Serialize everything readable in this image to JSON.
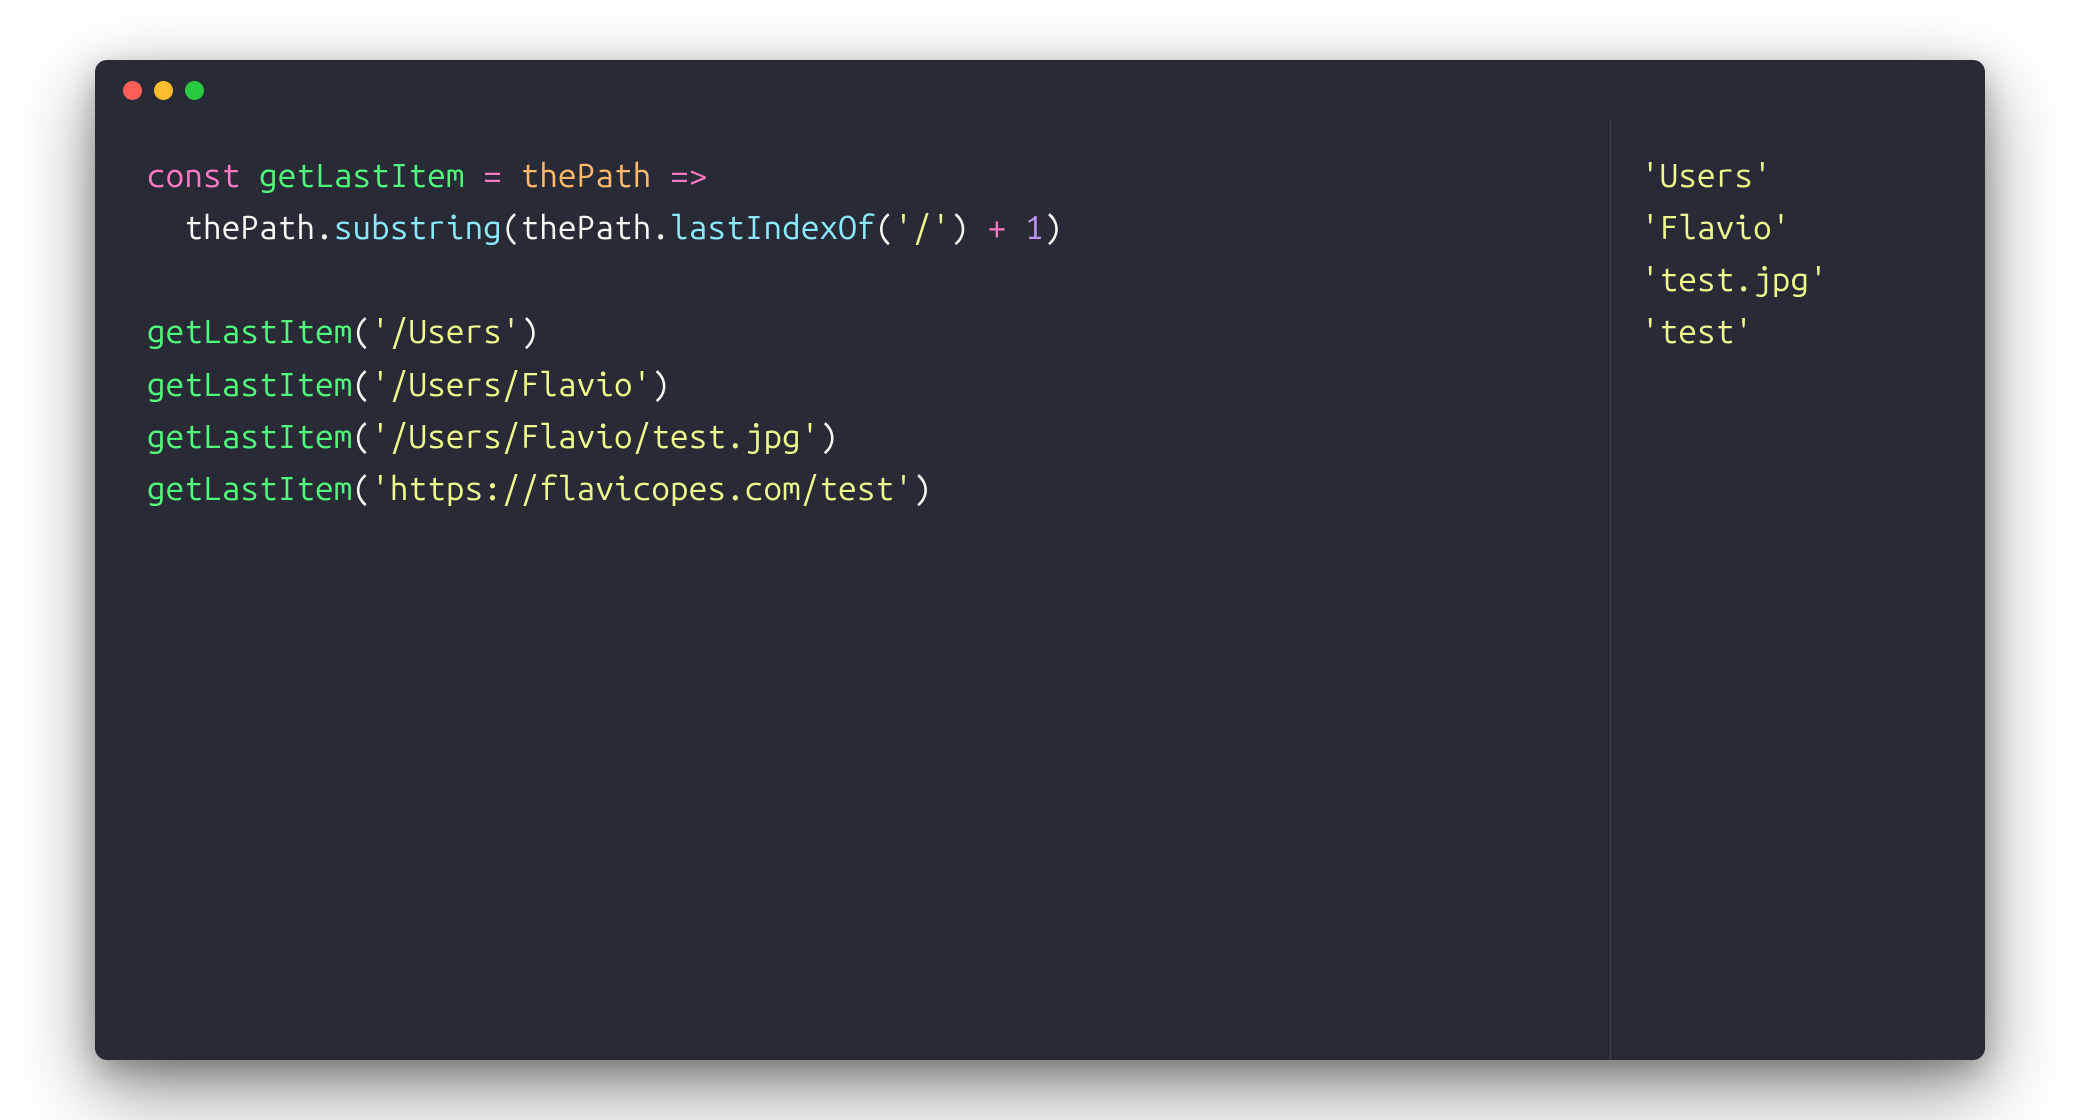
{
  "window": {
    "traffic_lights": [
      "close",
      "minimize",
      "zoom"
    ]
  },
  "code": {
    "lines": [
      [
        {
          "t": "const ",
          "c": "tok-keyword"
        },
        {
          "t": "getLastItem ",
          "c": "tok-func-def"
        },
        {
          "t": "= ",
          "c": "tok-operator"
        },
        {
          "t": "thePath ",
          "c": "tok-param"
        },
        {
          "t": "=>",
          "c": "tok-operator"
        }
      ],
      [
        {
          "t": "  thePath",
          "c": "tok-ident"
        },
        {
          "t": ".",
          "c": "tok-punct"
        },
        {
          "t": "substring",
          "c": "tok-method"
        },
        {
          "t": "(",
          "c": "tok-punct"
        },
        {
          "t": "thePath",
          "c": "tok-ident"
        },
        {
          "t": ".",
          "c": "tok-punct"
        },
        {
          "t": "lastIndexOf",
          "c": "tok-method"
        },
        {
          "t": "(",
          "c": "tok-punct"
        },
        {
          "t": "'/'",
          "c": "tok-string"
        },
        {
          "t": ") ",
          "c": "tok-punct"
        },
        {
          "t": "+ ",
          "c": "tok-operator"
        },
        {
          "t": "1",
          "c": "tok-number"
        },
        {
          "t": ")",
          "c": "tok-punct"
        }
      ],
      [],
      [
        {
          "t": "getLastItem",
          "c": "tok-func-call"
        },
        {
          "t": "(",
          "c": "tok-punct"
        },
        {
          "t": "'/Users'",
          "c": "tok-string"
        },
        {
          "t": ")",
          "c": "tok-punct"
        }
      ],
      [
        {
          "t": "getLastItem",
          "c": "tok-func-call"
        },
        {
          "t": "(",
          "c": "tok-punct"
        },
        {
          "t": "'/Users/Flavio'",
          "c": "tok-string"
        },
        {
          "t": ")",
          "c": "tok-punct"
        }
      ],
      [
        {
          "t": "getLastItem",
          "c": "tok-func-call"
        },
        {
          "t": "(",
          "c": "tok-punct"
        },
        {
          "t": "'/Users/Flavio/test.jpg'",
          "c": "tok-string"
        },
        {
          "t": ")",
          "c": "tok-punct"
        }
      ],
      [
        {
          "t": "getLastItem",
          "c": "tok-func-call"
        },
        {
          "t": "(",
          "c": "tok-punct"
        },
        {
          "t": "'https://flavicopes.com/test'",
          "c": "tok-string"
        },
        {
          "t": ")",
          "c": "tok-punct"
        }
      ]
    ]
  },
  "output": {
    "lines": [
      "'Users'",
      "'Flavio'",
      "'test.jpg'",
      "'test'"
    ]
  }
}
